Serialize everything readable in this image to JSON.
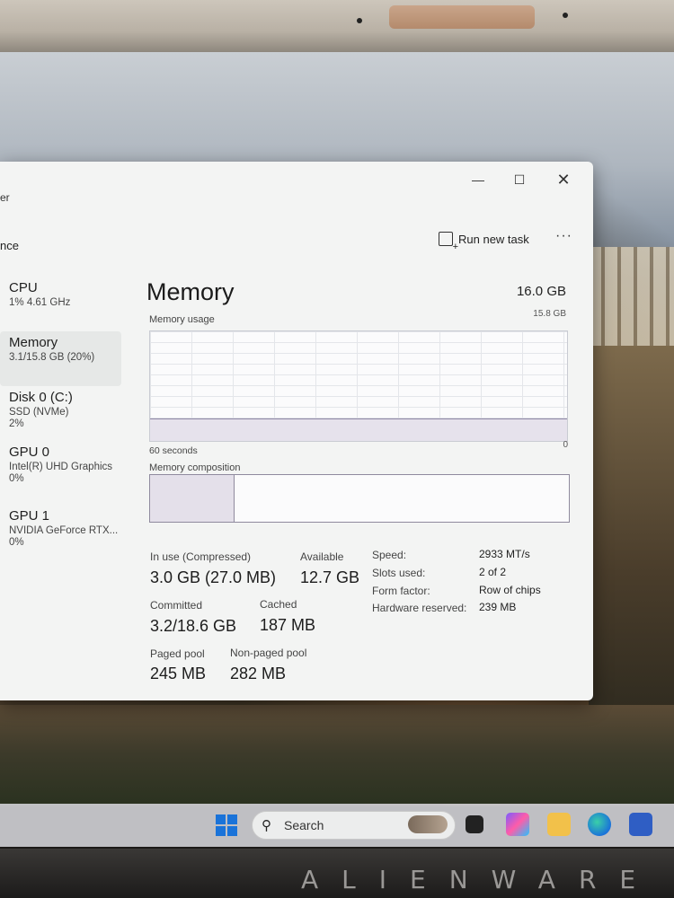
{
  "window": {
    "title_fragment": "er",
    "page_label_fragment": "nce",
    "run_new_task": "Run new task",
    "more": "···"
  },
  "nav": [
    {
      "name": "CPU",
      "sub": "1% 4.61 GHz",
      "sub2": ""
    },
    {
      "name": "Memory",
      "sub": "3.1/15.8 GB (20%)",
      "sub2": ""
    },
    {
      "name": "Disk 0 (C:)",
      "sub": "SSD (NVMe)",
      "sub2": "2%"
    },
    {
      "name": "GPU 0",
      "sub": "Intel(R) UHD Graphics",
      "sub2": "0%"
    },
    {
      "name": "GPU 1",
      "sub": "NVIDIA GeForce RTX...",
      "sub2": "0%"
    }
  ],
  "memory": {
    "title": "Memory",
    "total": "16.0 GB",
    "usage_label": "Memory usage",
    "usage_max": "15.8 GB",
    "time_label": "60 seconds",
    "zero_label": "0",
    "composition_label": "Memory composition",
    "usage_fraction": 0.2,
    "in_use_fraction": 0.2,
    "stats": {
      "in_use_label": "In use (Compressed)",
      "in_use_value": "3.0 GB (27.0 MB)",
      "available_label": "Available",
      "available_value": "12.7 GB",
      "committed_label": "Committed",
      "committed_value": "3.2/18.6 GB",
      "cached_label": "Cached",
      "cached_value": "187 MB",
      "paged_label": "Paged pool",
      "paged_value": "245 MB",
      "nonpaged_label": "Non-paged pool",
      "nonpaged_value": "282 MB"
    },
    "specs": {
      "speed_label": "Speed:",
      "speed_value": "2933 MT/s",
      "slots_label": "Slots used:",
      "slots_value": "2 of 2",
      "form_label": "Form factor:",
      "form_value": "Row of chips",
      "hw_label": "Hardware reserved:",
      "hw_value": "239 MB"
    }
  },
  "taskbar": {
    "search_placeholder": "Search"
  },
  "brand": "ALIENWARE",
  "colors": {
    "graph_line": "#8c84a3",
    "graph_fill": "#e6e2ec",
    "start_blue": "#1a73d9"
  }
}
